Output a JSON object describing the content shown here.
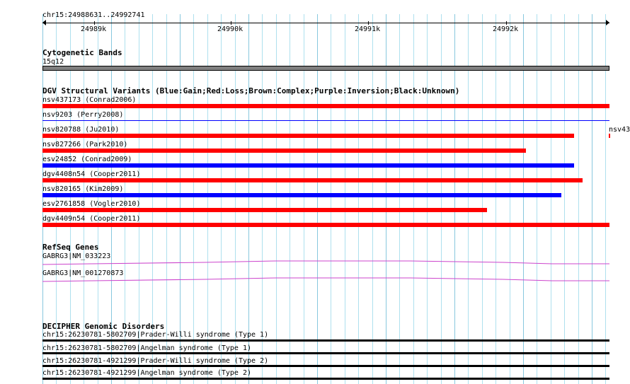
{
  "ruler": {
    "location": "chr15:24988631..24992741",
    "ticks": [
      "24989k",
      "24990k",
      "24991k",
      "24992k"
    ]
  },
  "tracks": {
    "cytoband": {
      "title": "Cytogenetic Bands",
      "band": "15q12",
      "color": "#808080"
    },
    "dgv": {
      "title": "DGV Structural Variants (Blue:Gain;Red:Loss;Brown:Complex;Purple:Inversion;Black:Unknown)",
      "legend": {
        "gain": "#0000ff",
        "loss": "#ff0000"
      },
      "features": [
        {
          "label": "nsv437173 (Conrad2006)",
          "type": "loss"
        },
        {
          "label": "nsv9203 (Perry2008)",
          "type": "gain"
        },
        {
          "label": "nsv820788 (Ju2010)",
          "type": "loss"
        },
        {
          "label": "nsv827266 (Park2010)",
          "type": "loss"
        },
        {
          "label": "esv24852 (Conrad2009)",
          "type": "gain"
        },
        {
          "label": "dgv4408n54 (Cooper2011)",
          "type": "loss"
        },
        {
          "label": "nsv820165 (Kim2009)",
          "type": "gain"
        },
        {
          "label": "esv2761858 (Vogler2010)",
          "type": "loss"
        },
        {
          "label": "dgv4409n54 (Cooper2011)",
          "type": "loss"
        }
      ],
      "side_label": "nsv43"
    },
    "refseq": {
      "title": "RefSeq Genes",
      "color": "#cc44cc",
      "features": [
        {
          "label": "GABRG3|NM_033223"
        },
        {
          "label": "GABRG3|NM_001270873"
        }
      ]
    },
    "decipher": {
      "title": "DECIPHER Genomic Disorders",
      "features": [
        {
          "label": "chr15:26230781-5802709|Prader-Willi syndrome (Type 1)"
        },
        {
          "label": "chr15:26230781-5802709|Angelman syndrome (Type 1)"
        },
        {
          "label": "chr15:26230781-4921299|Prader-Willi syndrome (Type 2)"
        },
        {
          "label": "chr15:26230781-4921299|Angelman syndrome (Type 2)"
        }
      ]
    }
  }
}
